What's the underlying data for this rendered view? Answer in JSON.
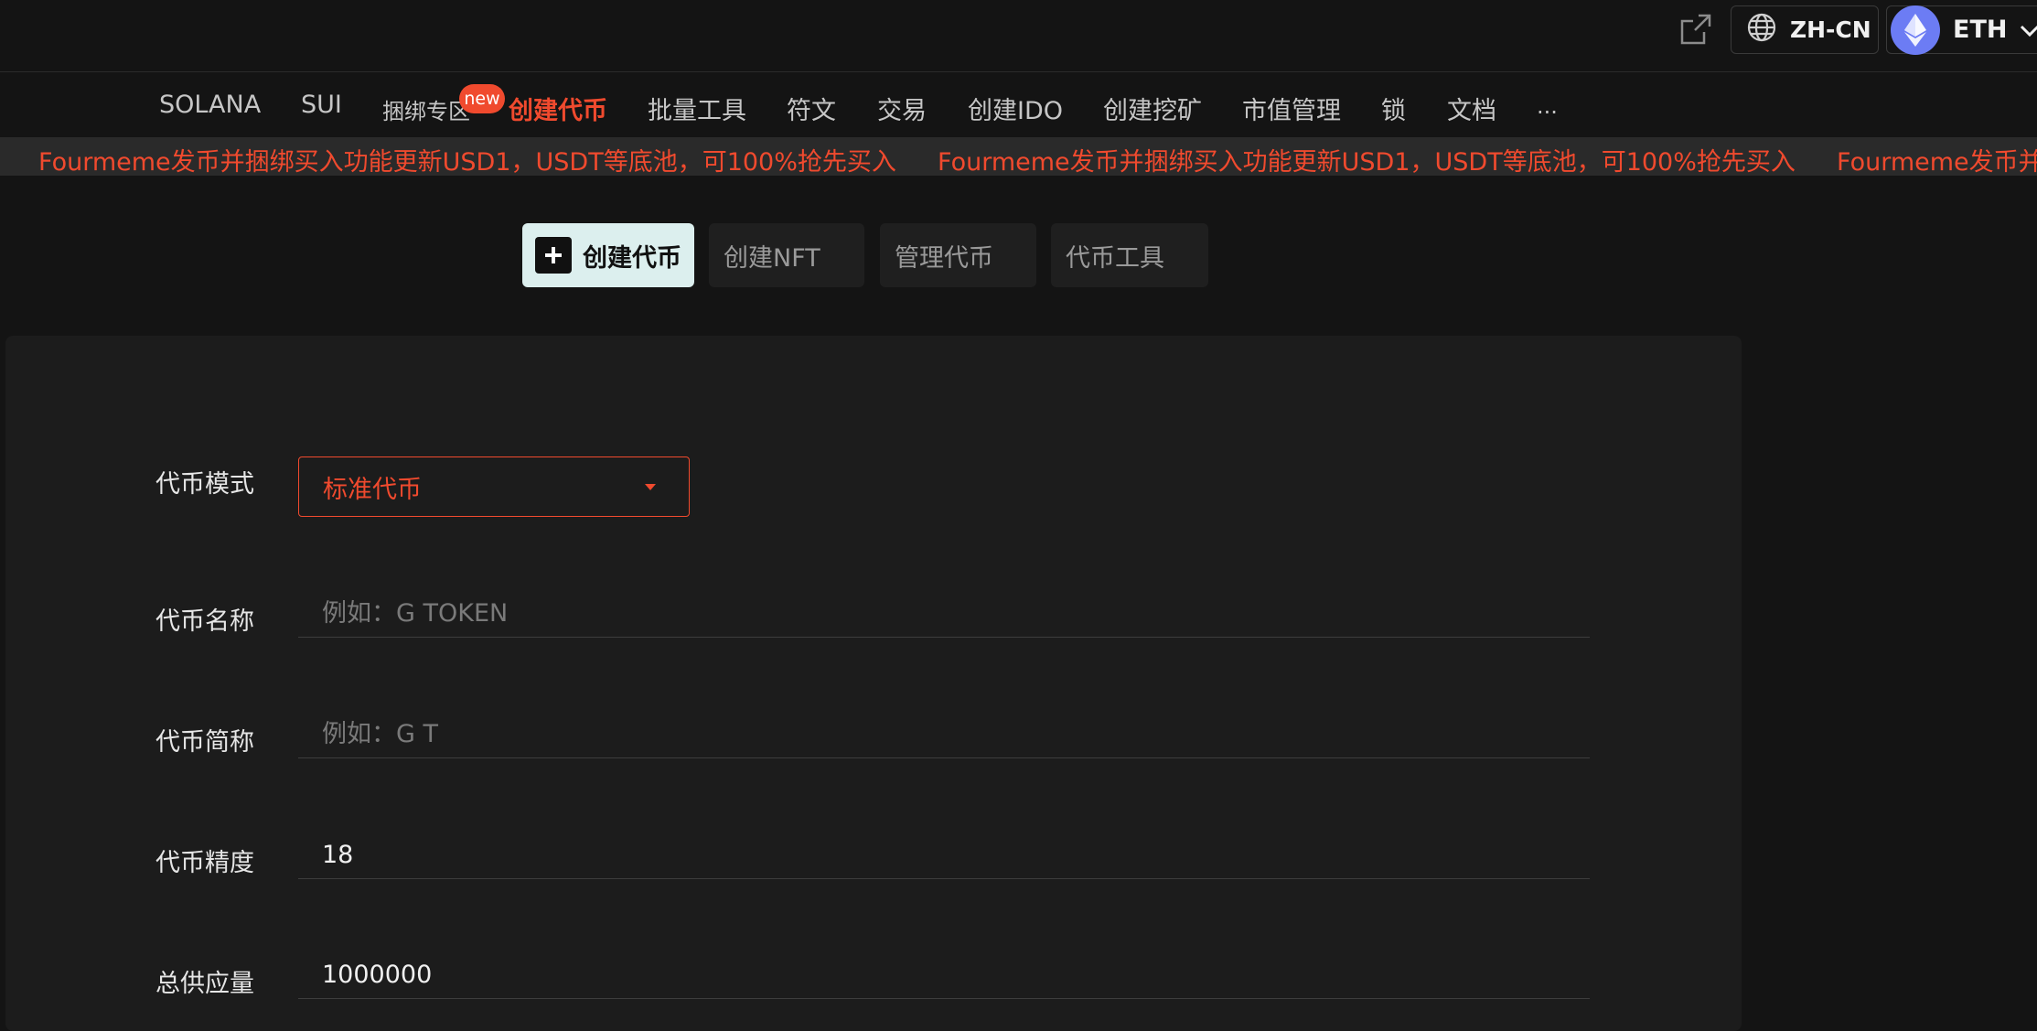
{
  "header": {
    "language": "ZH-CN",
    "chain": "ETH"
  },
  "nav": {
    "items": [
      {
        "label": "SOLANA"
      },
      {
        "label": "SUI"
      },
      {
        "label": "捆绑专区"
      },
      {
        "label": "创建代币"
      },
      {
        "label": "批量工具"
      },
      {
        "label": "符文"
      },
      {
        "label": "交易"
      },
      {
        "label": "创建IDO"
      },
      {
        "label": "创建挖矿"
      },
      {
        "label": "市值管理"
      },
      {
        "label": "锁"
      },
      {
        "label": "文档"
      },
      {
        "label": "..."
      }
    ],
    "badge": "new",
    "active_index": 3
  },
  "announcement": {
    "text": "Fourmeme发币并捆绑买入功能更新USD1，USDT等底池，可100%抢先买入",
    "text_cut": "Fourmeme发币并捆"
  },
  "tabs": [
    {
      "label": "创建代币"
    },
    {
      "label": "创建NFT"
    },
    {
      "label": "管理代币"
    },
    {
      "label": "代币工具"
    }
  ],
  "form": {
    "mode": {
      "label": "代币模式",
      "value": "标准代币"
    },
    "name": {
      "label": "代币名称",
      "placeholder": "例如：G TOKEN",
      "value": ""
    },
    "symbol": {
      "label": "代币简称",
      "placeholder": "例如：G T",
      "value": ""
    },
    "decimals": {
      "label": "代币精度",
      "value": "18"
    },
    "supply": {
      "label": "总供应量",
      "value": "1000000"
    }
  },
  "colors": {
    "accent": "#f04a2e",
    "background": "#141414",
    "panel": "#1c1c1c",
    "active_tab": "#dcefee",
    "eth": "#6c7cf4"
  }
}
